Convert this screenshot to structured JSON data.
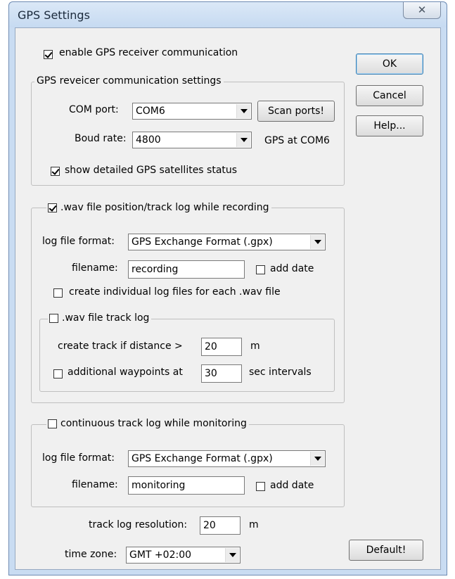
{
  "window": {
    "title": "GPS Settings",
    "close_glyph": "✕"
  },
  "buttons": {
    "ok": "OK",
    "cancel": "Cancel",
    "help": "Help...",
    "default": "Default!"
  },
  "enable_gps": {
    "label": "enable GPS receiver communication",
    "checked": true
  },
  "comm_group": {
    "title": "GPS reveicer communication settings",
    "com_port_label": "COM port:",
    "com_port_value": "COM6",
    "scan_ports": "Scan ports!",
    "baud_label": "Boud rate:",
    "baud_value": "4800",
    "gps_status": "GPS at COM6",
    "detailed_status": {
      "label": "show detailed GPS satellites status",
      "checked": true
    }
  },
  "wav_group": {
    "title": ".wav file position/track log while recording",
    "checked": true,
    "log_format_label": "log file format:",
    "log_format_value": "GPS Exchange Format (.gpx)",
    "filename_label": "filename:",
    "filename_value": "recording",
    "add_date": {
      "label": "add date",
      "checked": false
    },
    "individual_logs": {
      "label": "create individual log files for each .wav file",
      "checked": false
    },
    "track_group": {
      "title": ".wav file track log",
      "checked": false,
      "distance_label": "create track if distance >",
      "distance_value": "20",
      "distance_unit": "m",
      "waypoints": {
        "label": "additional waypoints at",
        "checked": false
      },
      "waypoints_value": "30",
      "waypoints_unit": "sec intervals"
    }
  },
  "monitor_group": {
    "title": "continuous track log while monitoring",
    "checked": false,
    "log_format_label": "log file format:",
    "log_format_value": "GPS Exchange Format (.gpx)",
    "filename_label": "filename:",
    "filename_value": "monitoring",
    "add_date": {
      "label": "add date",
      "checked": false
    }
  },
  "resolution": {
    "label": "track log resolution:",
    "value": "20",
    "unit": "m"
  },
  "timezone": {
    "label": "time zone:",
    "value": "GMT +02:00"
  },
  "colors": {
    "frame": "#c9dcf2",
    "client": "#f0f0f0",
    "default_button_border": "#3c7fb1"
  }
}
